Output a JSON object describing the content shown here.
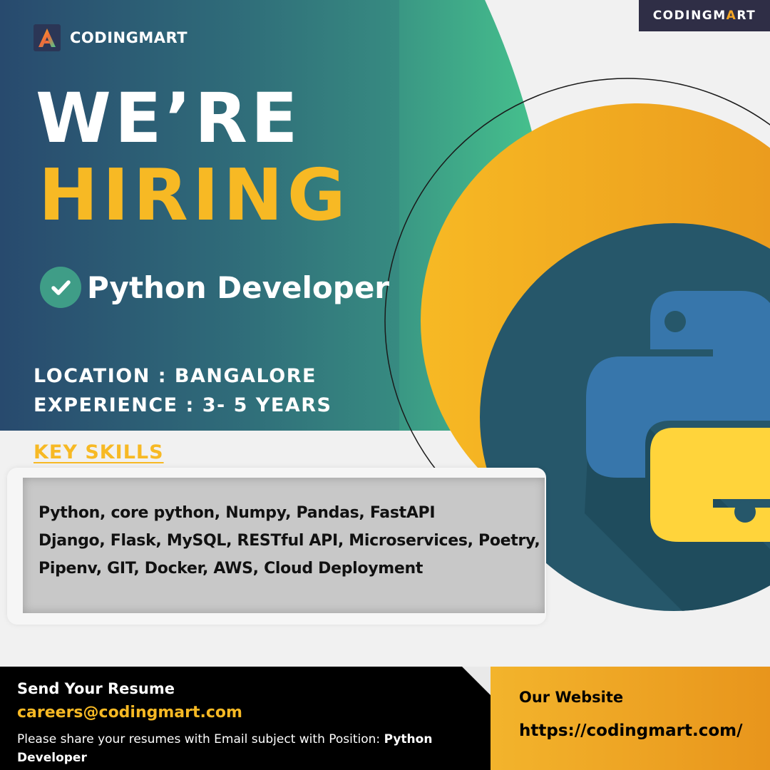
{
  "badge": {
    "prefix": "CODINGM",
    "accent": "A",
    "suffix": "RT"
  },
  "brand": {
    "name": "CODINGMART",
    "logo_icon": "codingmart-logo-icon"
  },
  "headline": {
    "line1": "WE’RE",
    "line2": "HIRING"
  },
  "role": {
    "icon": "check-circle-icon",
    "title": "Python Developer"
  },
  "details": {
    "location": "LOCATION : BANGALORE",
    "experience": "EXPERIENCE : 3- 5 YEARS"
  },
  "skills": {
    "heading": "KEY SKILLS",
    "lines": [
      "Python, core python, Numpy, Pandas, FastAPI",
      "Django, Flask, MySQL, RESTful API, Microservices, Poetry,",
      "Pipenv, GIT, Docker, AWS, Cloud Deployment"
    ]
  },
  "footer": {
    "send_title": "Send Your Resume",
    "email": "careers@codingmart.com",
    "note_text": "Please share your resumes with Email subject with Position: ",
    "note_position": "Python Developer",
    "site_title": "Our Website",
    "site_url": "https://codingmart.com/"
  },
  "colors": {
    "hero_start": "#284a6e",
    "hero_end": "#48c98f",
    "accent_yellow": "#f7b924",
    "orange": "#e8951c",
    "python_blue": "#3776ab",
    "python_yellow": "#ffd43b",
    "teal_circle": "#26576a"
  },
  "illustration": {
    "icon": "python-logo-icon"
  }
}
